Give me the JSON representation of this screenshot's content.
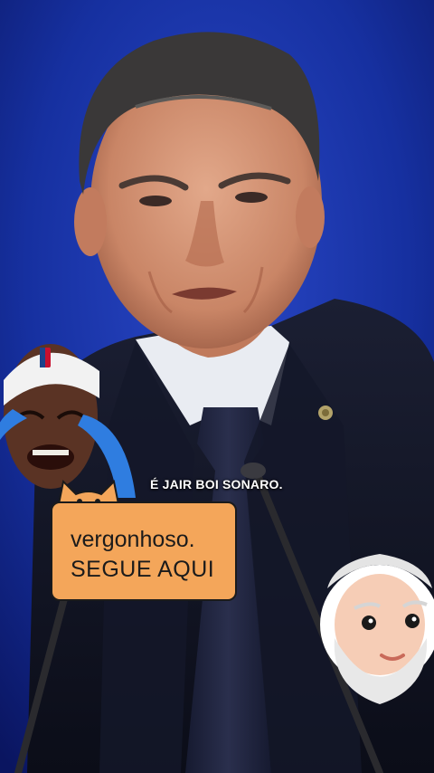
{
  "video": {
    "caption": "É JAIR BOI SONARO."
  },
  "bubble_sticker": {
    "line1": "vergonhoso.",
    "line2": "SEGUE AQUI"
  },
  "colors": {
    "background": "#0d1a6e",
    "bubble_fill": "#f4a65a",
    "bubble_outline": "#1b1b1b",
    "tears": "#2f7de0",
    "caption_text": "#ffffff"
  },
  "stickers": {
    "crying_face_icon": "crying-face-sticker",
    "bubble_icon": "cat-bubble-sticker",
    "old_man_icon": "bearded-old-man-sticker"
  }
}
